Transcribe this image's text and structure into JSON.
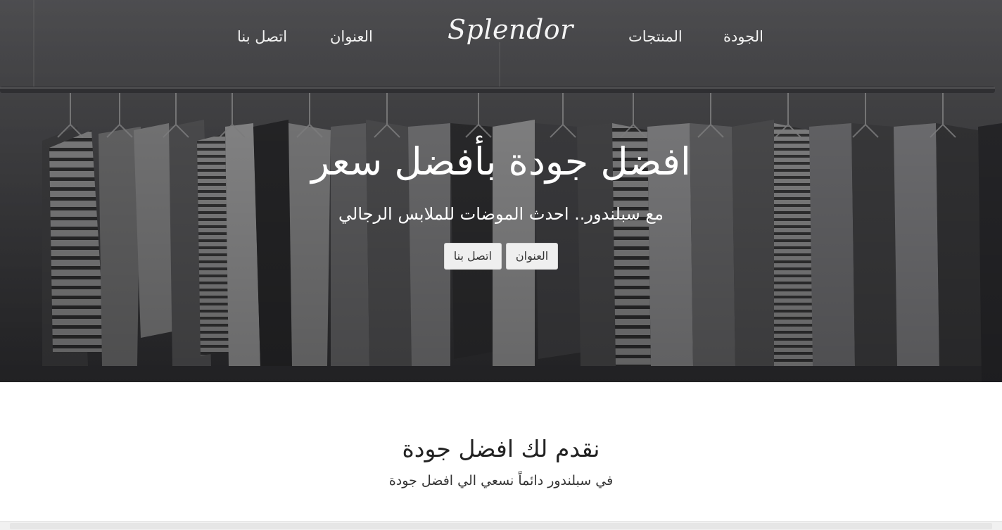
{
  "nav": {
    "quality": "الجودة",
    "products": "المنتجات",
    "logo": "Splendor",
    "address": "العنوان",
    "contact": "اتصل بنا"
  },
  "hero": {
    "title": "افضل جودة بأفضل سعر",
    "subtitle": "مع سبلندور.. احدث الموضات للملابس الرجالي",
    "buttons": {
      "address": "العنوان",
      "contact": "اتصل بنا"
    }
  },
  "section": {
    "title": "نقدم لك افضل جودة",
    "subtitle": "في سبلندور دائماً نسعي الي افضل جودة"
  },
  "colors": {
    "hero_overlay": "#555558",
    "text_light": "#ffffff",
    "button_bg": "#efefef"
  }
}
